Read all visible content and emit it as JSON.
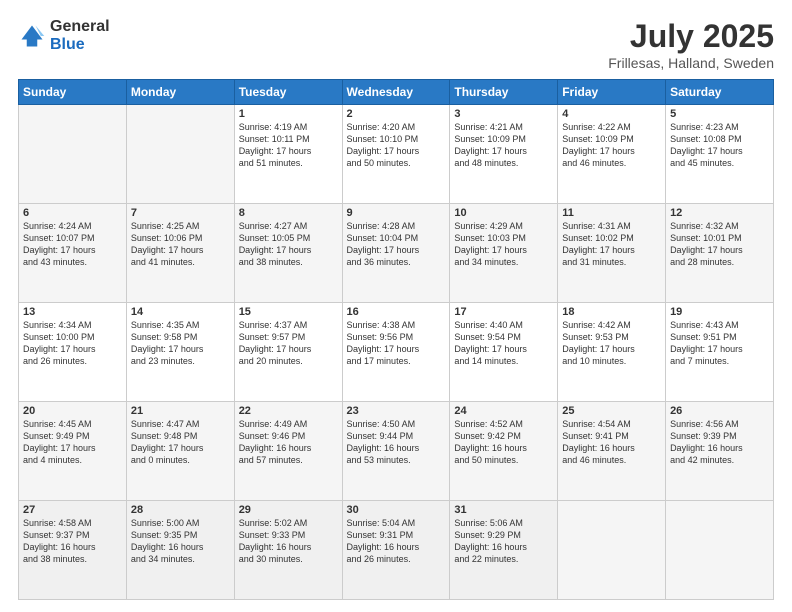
{
  "logo": {
    "general": "General",
    "blue": "Blue"
  },
  "title": {
    "month": "July 2025",
    "location": "Frillesas, Halland, Sweden"
  },
  "days_header": [
    "Sunday",
    "Monday",
    "Tuesday",
    "Wednesday",
    "Thursday",
    "Friday",
    "Saturday"
  ],
  "weeks": [
    [
      {
        "num": "",
        "info": ""
      },
      {
        "num": "",
        "info": ""
      },
      {
        "num": "1",
        "info": "Sunrise: 4:19 AM\nSunset: 10:11 PM\nDaylight: 17 hours\nand 51 minutes."
      },
      {
        "num": "2",
        "info": "Sunrise: 4:20 AM\nSunset: 10:10 PM\nDaylight: 17 hours\nand 50 minutes."
      },
      {
        "num": "3",
        "info": "Sunrise: 4:21 AM\nSunset: 10:09 PM\nDaylight: 17 hours\nand 48 minutes."
      },
      {
        "num": "4",
        "info": "Sunrise: 4:22 AM\nSunset: 10:09 PM\nDaylight: 17 hours\nand 46 minutes."
      },
      {
        "num": "5",
        "info": "Sunrise: 4:23 AM\nSunset: 10:08 PM\nDaylight: 17 hours\nand 45 minutes."
      }
    ],
    [
      {
        "num": "6",
        "info": "Sunrise: 4:24 AM\nSunset: 10:07 PM\nDaylight: 17 hours\nand 43 minutes."
      },
      {
        "num": "7",
        "info": "Sunrise: 4:25 AM\nSunset: 10:06 PM\nDaylight: 17 hours\nand 41 minutes."
      },
      {
        "num": "8",
        "info": "Sunrise: 4:27 AM\nSunset: 10:05 PM\nDaylight: 17 hours\nand 38 minutes."
      },
      {
        "num": "9",
        "info": "Sunrise: 4:28 AM\nSunset: 10:04 PM\nDaylight: 17 hours\nand 36 minutes."
      },
      {
        "num": "10",
        "info": "Sunrise: 4:29 AM\nSunset: 10:03 PM\nDaylight: 17 hours\nand 34 minutes."
      },
      {
        "num": "11",
        "info": "Sunrise: 4:31 AM\nSunset: 10:02 PM\nDaylight: 17 hours\nand 31 minutes."
      },
      {
        "num": "12",
        "info": "Sunrise: 4:32 AM\nSunset: 10:01 PM\nDaylight: 17 hours\nand 28 minutes."
      }
    ],
    [
      {
        "num": "13",
        "info": "Sunrise: 4:34 AM\nSunset: 10:00 PM\nDaylight: 17 hours\nand 26 minutes."
      },
      {
        "num": "14",
        "info": "Sunrise: 4:35 AM\nSunset: 9:58 PM\nDaylight: 17 hours\nand 23 minutes."
      },
      {
        "num": "15",
        "info": "Sunrise: 4:37 AM\nSunset: 9:57 PM\nDaylight: 17 hours\nand 20 minutes."
      },
      {
        "num": "16",
        "info": "Sunrise: 4:38 AM\nSunset: 9:56 PM\nDaylight: 17 hours\nand 17 minutes."
      },
      {
        "num": "17",
        "info": "Sunrise: 4:40 AM\nSunset: 9:54 PM\nDaylight: 17 hours\nand 14 minutes."
      },
      {
        "num": "18",
        "info": "Sunrise: 4:42 AM\nSunset: 9:53 PM\nDaylight: 17 hours\nand 10 minutes."
      },
      {
        "num": "19",
        "info": "Sunrise: 4:43 AM\nSunset: 9:51 PM\nDaylight: 17 hours\nand 7 minutes."
      }
    ],
    [
      {
        "num": "20",
        "info": "Sunrise: 4:45 AM\nSunset: 9:49 PM\nDaylight: 17 hours\nand 4 minutes."
      },
      {
        "num": "21",
        "info": "Sunrise: 4:47 AM\nSunset: 9:48 PM\nDaylight: 17 hours\nand 0 minutes."
      },
      {
        "num": "22",
        "info": "Sunrise: 4:49 AM\nSunset: 9:46 PM\nDaylight: 16 hours\nand 57 minutes."
      },
      {
        "num": "23",
        "info": "Sunrise: 4:50 AM\nSunset: 9:44 PM\nDaylight: 16 hours\nand 53 minutes."
      },
      {
        "num": "24",
        "info": "Sunrise: 4:52 AM\nSunset: 9:42 PM\nDaylight: 16 hours\nand 50 minutes."
      },
      {
        "num": "25",
        "info": "Sunrise: 4:54 AM\nSunset: 9:41 PM\nDaylight: 16 hours\nand 46 minutes."
      },
      {
        "num": "26",
        "info": "Sunrise: 4:56 AM\nSunset: 9:39 PM\nDaylight: 16 hours\nand 42 minutes."
      }
    ],
    [
      {
        "num": "27",
        "info": "Sunrise: 4:58 AM\nSunset: 9:37 PM\nDaylight: 16 hours\nand 38 minutes."
      },
      {
        "num": "28",
        "info": "Sunrise: 5:00 AM\nSunset: 9:35 PM\nDaylight: 16 hours\nand 34 minutes."
      },
      {
        "num": "29",
        "info": "Sunrise: 5:02 AM\nSunset: 9:33 PM\nDaylight: 16 hours\nand 30 minutes."
      },
      {
        "num": "30",
        "info": "Sunrise: 5:04 AM\nSunset: 9:31 PM\nDaylight: 16 hours\nand 26 minutes."
      },
      {
        "num": "31",
        "info": "Sunrise: 5:06 AM\nSunset: 9:29 PM\nDaylight: 16 hours\nand 22 minutes."
      },
      {
        "num": "",
        "info": ""
      },
      {
        "num": "",
        "info": ""
      }
    ]
  ]
}
